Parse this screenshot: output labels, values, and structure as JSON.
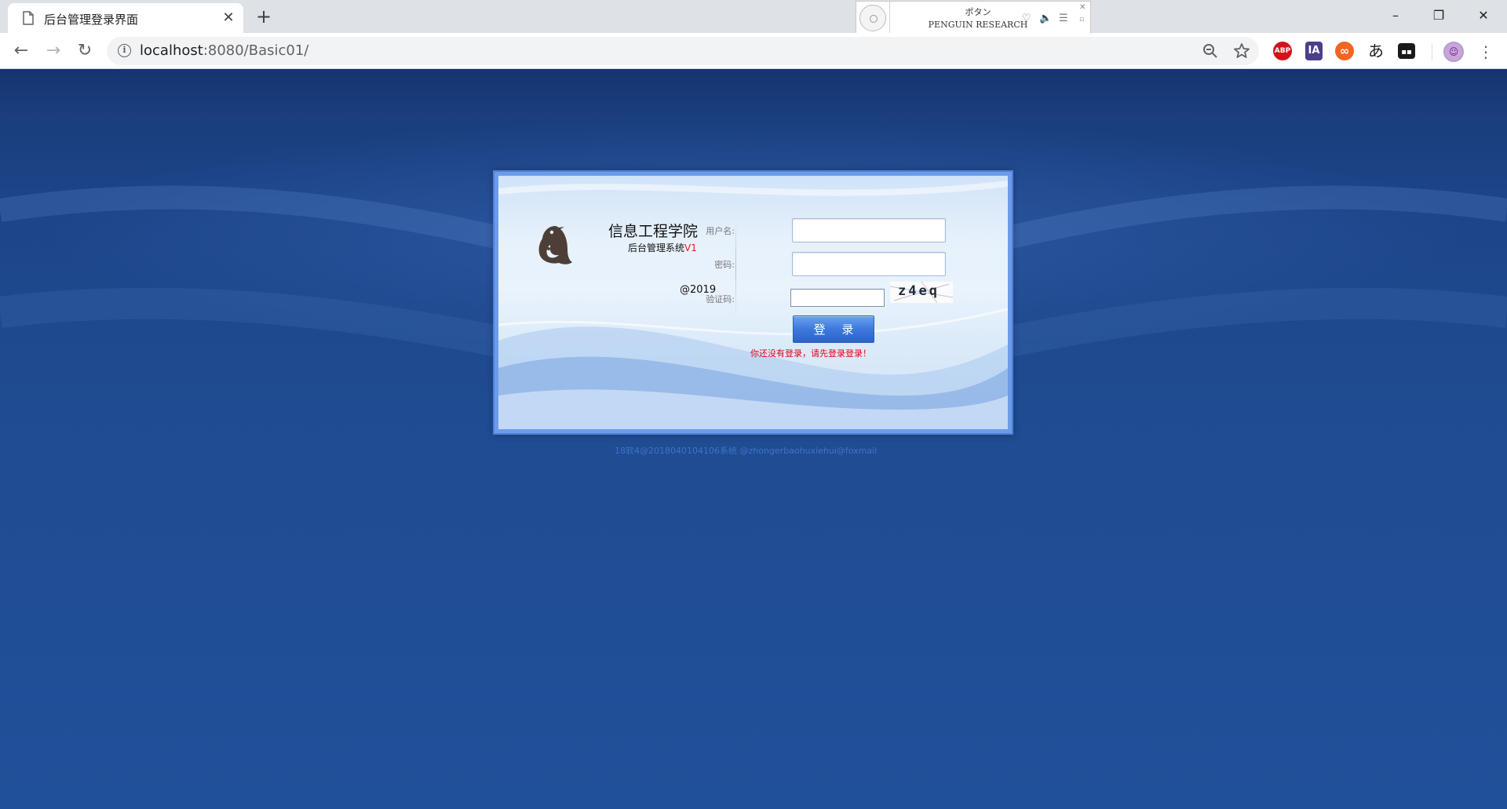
{
  "browser": {
    "tab": {
      "title": "后台管理登录界面",
      "close_glyph": "✕",
      "new_tab_glyph": "+"
    },
    "media": {
      "title": "ポタン",
      "artist": "PENGUIN RESEARCH",
      "close_glyph": "✕",
      "mini_glyph": "▫"
    },
    "window_controls": {
      "minimize": "–",
      "restore": "❐",
      "close": "✕"
    },
    "nav": {
      "back": "←",
      "forward": "→",
      "reload": "↻"
    },
    "address": {
      "host": "localhost",
      "rest": ":8080/Basic01/"
    },
    "extensions": {
      "abp": "ABP",
      "ia": "IA",
      "infinity": "∞",
      "hiragana": "あ",
      "toolbox": "▪▪"
    },
    "menu_glyph": "⋮",
    "icons": [
      "page-icon",
      "info-icon",
      "zoom-out-icon",
      "star-icon",
      "heart-icon",
      "volume-icon",
      "playlist-icon",
      "avatar-icon"
    ]
  },
  "login": {
    "school_name": "信息工程学院",
    "system_name": "后台管理系统",
    "version": "V1",
    "copyright": "@2019",
    "username_label": "用户名:",
    "password_label": "密码:",
    "captcha_label": "验证码:",
    "username_value": "",
    "password_value": "",
    "captcha_value": "",
    "captcha_image_text": "z4eq",
    "login_button": "登 录",
    "error_message": "你还没有登录，请先登录登录！",
    "colors": {
      "error": "#e60012",
      "version": "#e32020",
      "button": "#3d79dd",
      "page_bg": "#1f4b91"
    }
  },
  "footer": {
    "text": "18软4@2018040104106系统  @zhongerbaohuxiehui@foxmail"
  }
}
